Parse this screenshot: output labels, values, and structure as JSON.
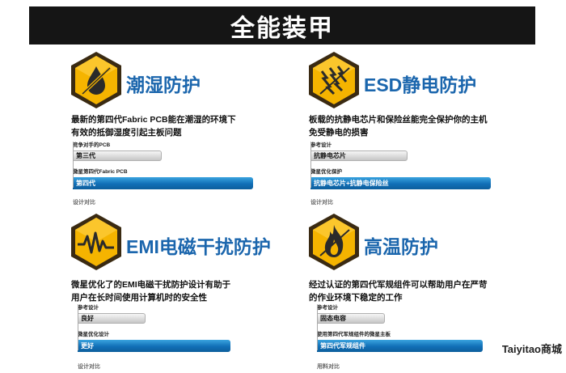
{
  "banner": {
    "title": "全能装甲"
  },
  "features": [
    {
      "title": "潮湿防护",
      "icon": "humidity-icon",
      "desc": [
        "最新的第四代Fabric PCB能在潮湿的环境下",
        "有效的抵御湿度引起主板问题"
      ],
      "compare": [
        {
          "label": "竞争对手的PCB",
          "value": "第三代",
          "fill": 0.46
        },
        {
          "label": "微星第四代Fabric PCB",
          "value": "第四代",
          "fill": 0.93
        }
      ],
      "footer": "设计对比"
    },
    {
      "title": "ESD静电防护",
      "icon": "esd-lightning-icon",
      "desc": [
        "板载的抗静电芯片和保险丝能完全保护你的主机",
        "免受静电的损害"
      ],
      "compare": [
        {
          "label": "参考设计",
          "value": "抗静电芯片",
          "fill": 0.5
        },
        {
          "label": "微星优化保护",
          "value": "抗静电芯片+抗静电保险丝",
          "fill": 0.93
        }
      ],
      "footer": "设计对比"
    },
    {
      "title": "EMI电磁干扰防护",
      "icon": "emi-wave-icon",
      "desc": [
        "微星优化了的EMI电磁干扰防护设计有助于",
        "用户在长时间使用计算机时的安全性"
      ],
      "compare": [
        {
          "label": "参考设计",
          "value": "良好",
          "fill": 0.38
        },
        {
          "label": "微星优化设计",
          "value": "更好",
          "fill": 0.81
        }
      ],
      "footer": "设计对比"
    },
    {
      "title": "高温防护",
      "icon": "flame-icon",
      "desc": [
        "经过认证的第四代军规组件可以帮助用户在严苛",
        "的作业环境下稳定的工作"
      ],
      "compare": [
        {
          "label": "参考设计",
          "value": "固态电容",
          "fill": 0.38
        },
        {
          "label": "使用第四代军规组件的微星主板",
          "value": "第四代军规组件",
          "fill": 0.93
        }
      ],
      "footer": "用料对比"
    }
  ],
  "watermark": "Taiyitao商城",
  "colors": {
    "accent": "#1b66ad",
    "bar_blue": "#116fb7",
    "hex_gold": "#f5b400",
    "banner_bg": "#151515"
  }
}
